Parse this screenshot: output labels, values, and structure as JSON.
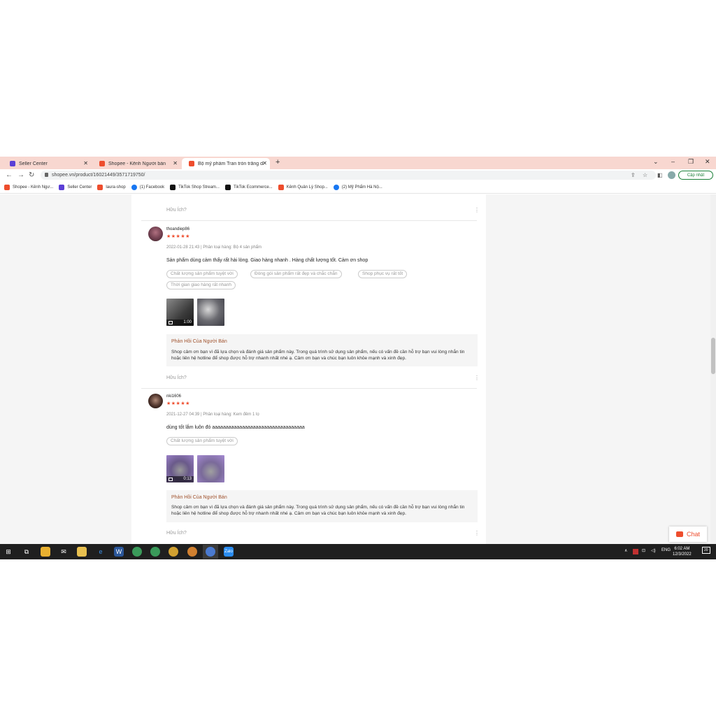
{
  "browser": {
    "tabs": [
      {
        "label": "Seller Center",
        "color": "#5b3fd6"
      },
      {
        "label": "Shopee - Kênh Người bán",
        "color": "#ee4d2d"
      },
      {
        "label": "Bộ mỹ phẩm Tran tròn trắng da ·",
        "color": "#ee4d2d"
      }
    ],
    "new_tab": "+",
    "url": "shopee.vn/product/16021449/3571719750/",
    "update_button": "Cập nhật",
    "bookmarks": [
      {
        "label": "Shopee - Kênh Ngư...",
        "color": "#ee4d2d"
      },
      {
        "label": "Seller Center",
        "color": "#5b3fd6"
      },
      {
        "label": "laura-shop",
        "color": "#ee4d2d"
      },
      {
        "label": "(1) Facebook",
        "color": "#1877f2"
      },
      {
        "label": "TikTok Shop Stream...",
        "color": "#111111"
      },
      {
        "label": "TikTok Ecommerce...",
        "color": "#111111"
      },
      {
        "label": "Kênh Quản Lý Shop...",
        "color": "#ee4d2d"
      },
      {
        "label": "(2) Mỹ Phẩm Hà Nộ...",
        "color": "#1877f2"
      }
    ]
  },
  "page": {
    "helpful_label": "Hữu Ích?",
    "more_icon": "⋮",
    "reviews": [
      {
        "username": "thoandiep86",
        "stars": "★★★★★",
        "meta": "2022-01-28 21:43 | Phân loại hàng: Bộ 4 sản phẩm",
        "body": "Sản phẩm dùng cảm thấy rất hài lòng. Giao hàng nhanh . Hàng chất lượng tốt. Cảm ơn shop",
        "tags": [
          "Chất lượng sản phẩm tuyệt vời",
          "Đóng gói sản phẩm rất đẹp và chắc chắn",
          "Shop phục vụ rất tốt",
          "Thời gian giao hàng rất nhanh"
        ],
        "video_duration": "1:00",
        "reply_title": "Phản Hồi Của Người Bán",
        "reply_body": "Shop cảm ơn bạn vì đã lựa chọn và đánh giá sản phẩm này. Trong quá trình sử dụng sản phẩm, nếu có vấn đề cần hỗ trợ bạn vui lòng nhắn tin hoặc liên hệ hotline để shop được hỗ trợ nhanh nhất nhé ạ. Cảm ơn bạn và chúc bạn luôn khỏe mạnh và xinh đẹp."
      },
      {
        "username": "nki1606",
        "stars": "★★★★★",
        "meta": "2021-12-27 04:39 | Phân loại hàng: Kem đêm 1 lọ",
        "body": "dùng tốt lắm luôn đó aaaaaaaaaaaaaaaaaaaaaaaaaaaaaaaaaa",
        "tags": [
          "Chất lượng sản phẩm tuyệt vời"
        ],
        "video_duration": "0:13",
        "reply_title": "Phản Hồi Của Người Bán",
        "reply_body": "Shop cảm ơn bạn vì đã lựa chọn và đánh giá sản phẩm này. Trong quá trình sử dụng sản phẩm, nếu có vấn đề cần hỗ trợ bạn vui lòng nhắn tin hoặc liên hệ hotline để shop được hỗ trợ nhanh nhất nhé ạ. Cảm ơn bạn và chúc bạn luôn khỏe mạnh và xinh đẹp."
      }
    ],
    "chat_label": "Chat"
  },
  "taskbar": {
    "language": "ENG",
    "time": "6:02 AM",
    "date": "12/3/2022",
    "notification_count": "20"
  }
}
